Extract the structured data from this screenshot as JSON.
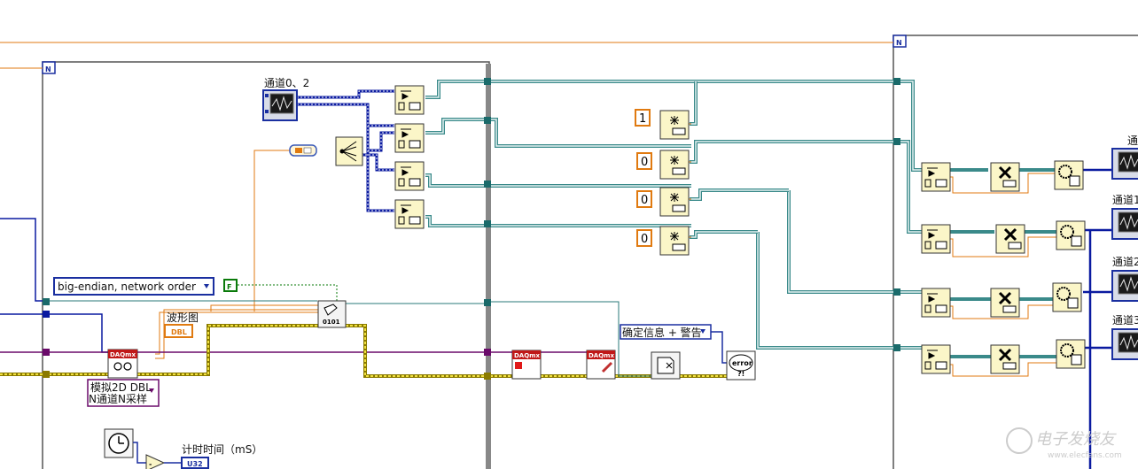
{
  "loops": {
    "left_loop_label": "N",
    "right_loop_label": "N"
  },
  "labels": {
    "channel_0_2": "通道0、2",
    "waveform_graph": "波形图",
    "timer_label": "计时时间（mS）",
    "channel_0": "通道",
    "channel_1": "通道1",
    "channel_2": "通道2",
    "channel_3": "通道3"
  },
  "controls": {
    "byte_order": "big-endian, network order",
    "bool_constant": "F",
    "analog_mode_line1": "模拟2D DBL",
    "analog_mode_line2": "N通道N采样",
    "error_mode": "确定信息 + 警告",
    "dbl_indicator": "DBL",
    "u32_indicator": "U32"
  },
  "constants": {
    "index_1": "1",
    "index_2": "0",
    "index_3": "0",
    "index_4": "0"
  },
  "nodes": {
    "daq_read": "DAQmx",
    "daq_stop": "DAQmx",
    "daq_clear": "DAQmx",
    "error_handler": "error",
    "file_write": "0101"
  },
  "watermark": {
    "text": "电子发烧友",
    "url": "www.elecfans.com"
  },
  "colors": {
    "orange_wire": "#e07a10",
    "cluster_wire": "#3a8a8a",
    "error_wire": "#c8b400",
    "blue_wire": "#0a1aa0",
    "task_wire": "#6a0a6a",
    "node_fill": "#fbf6c8"
  }
}
